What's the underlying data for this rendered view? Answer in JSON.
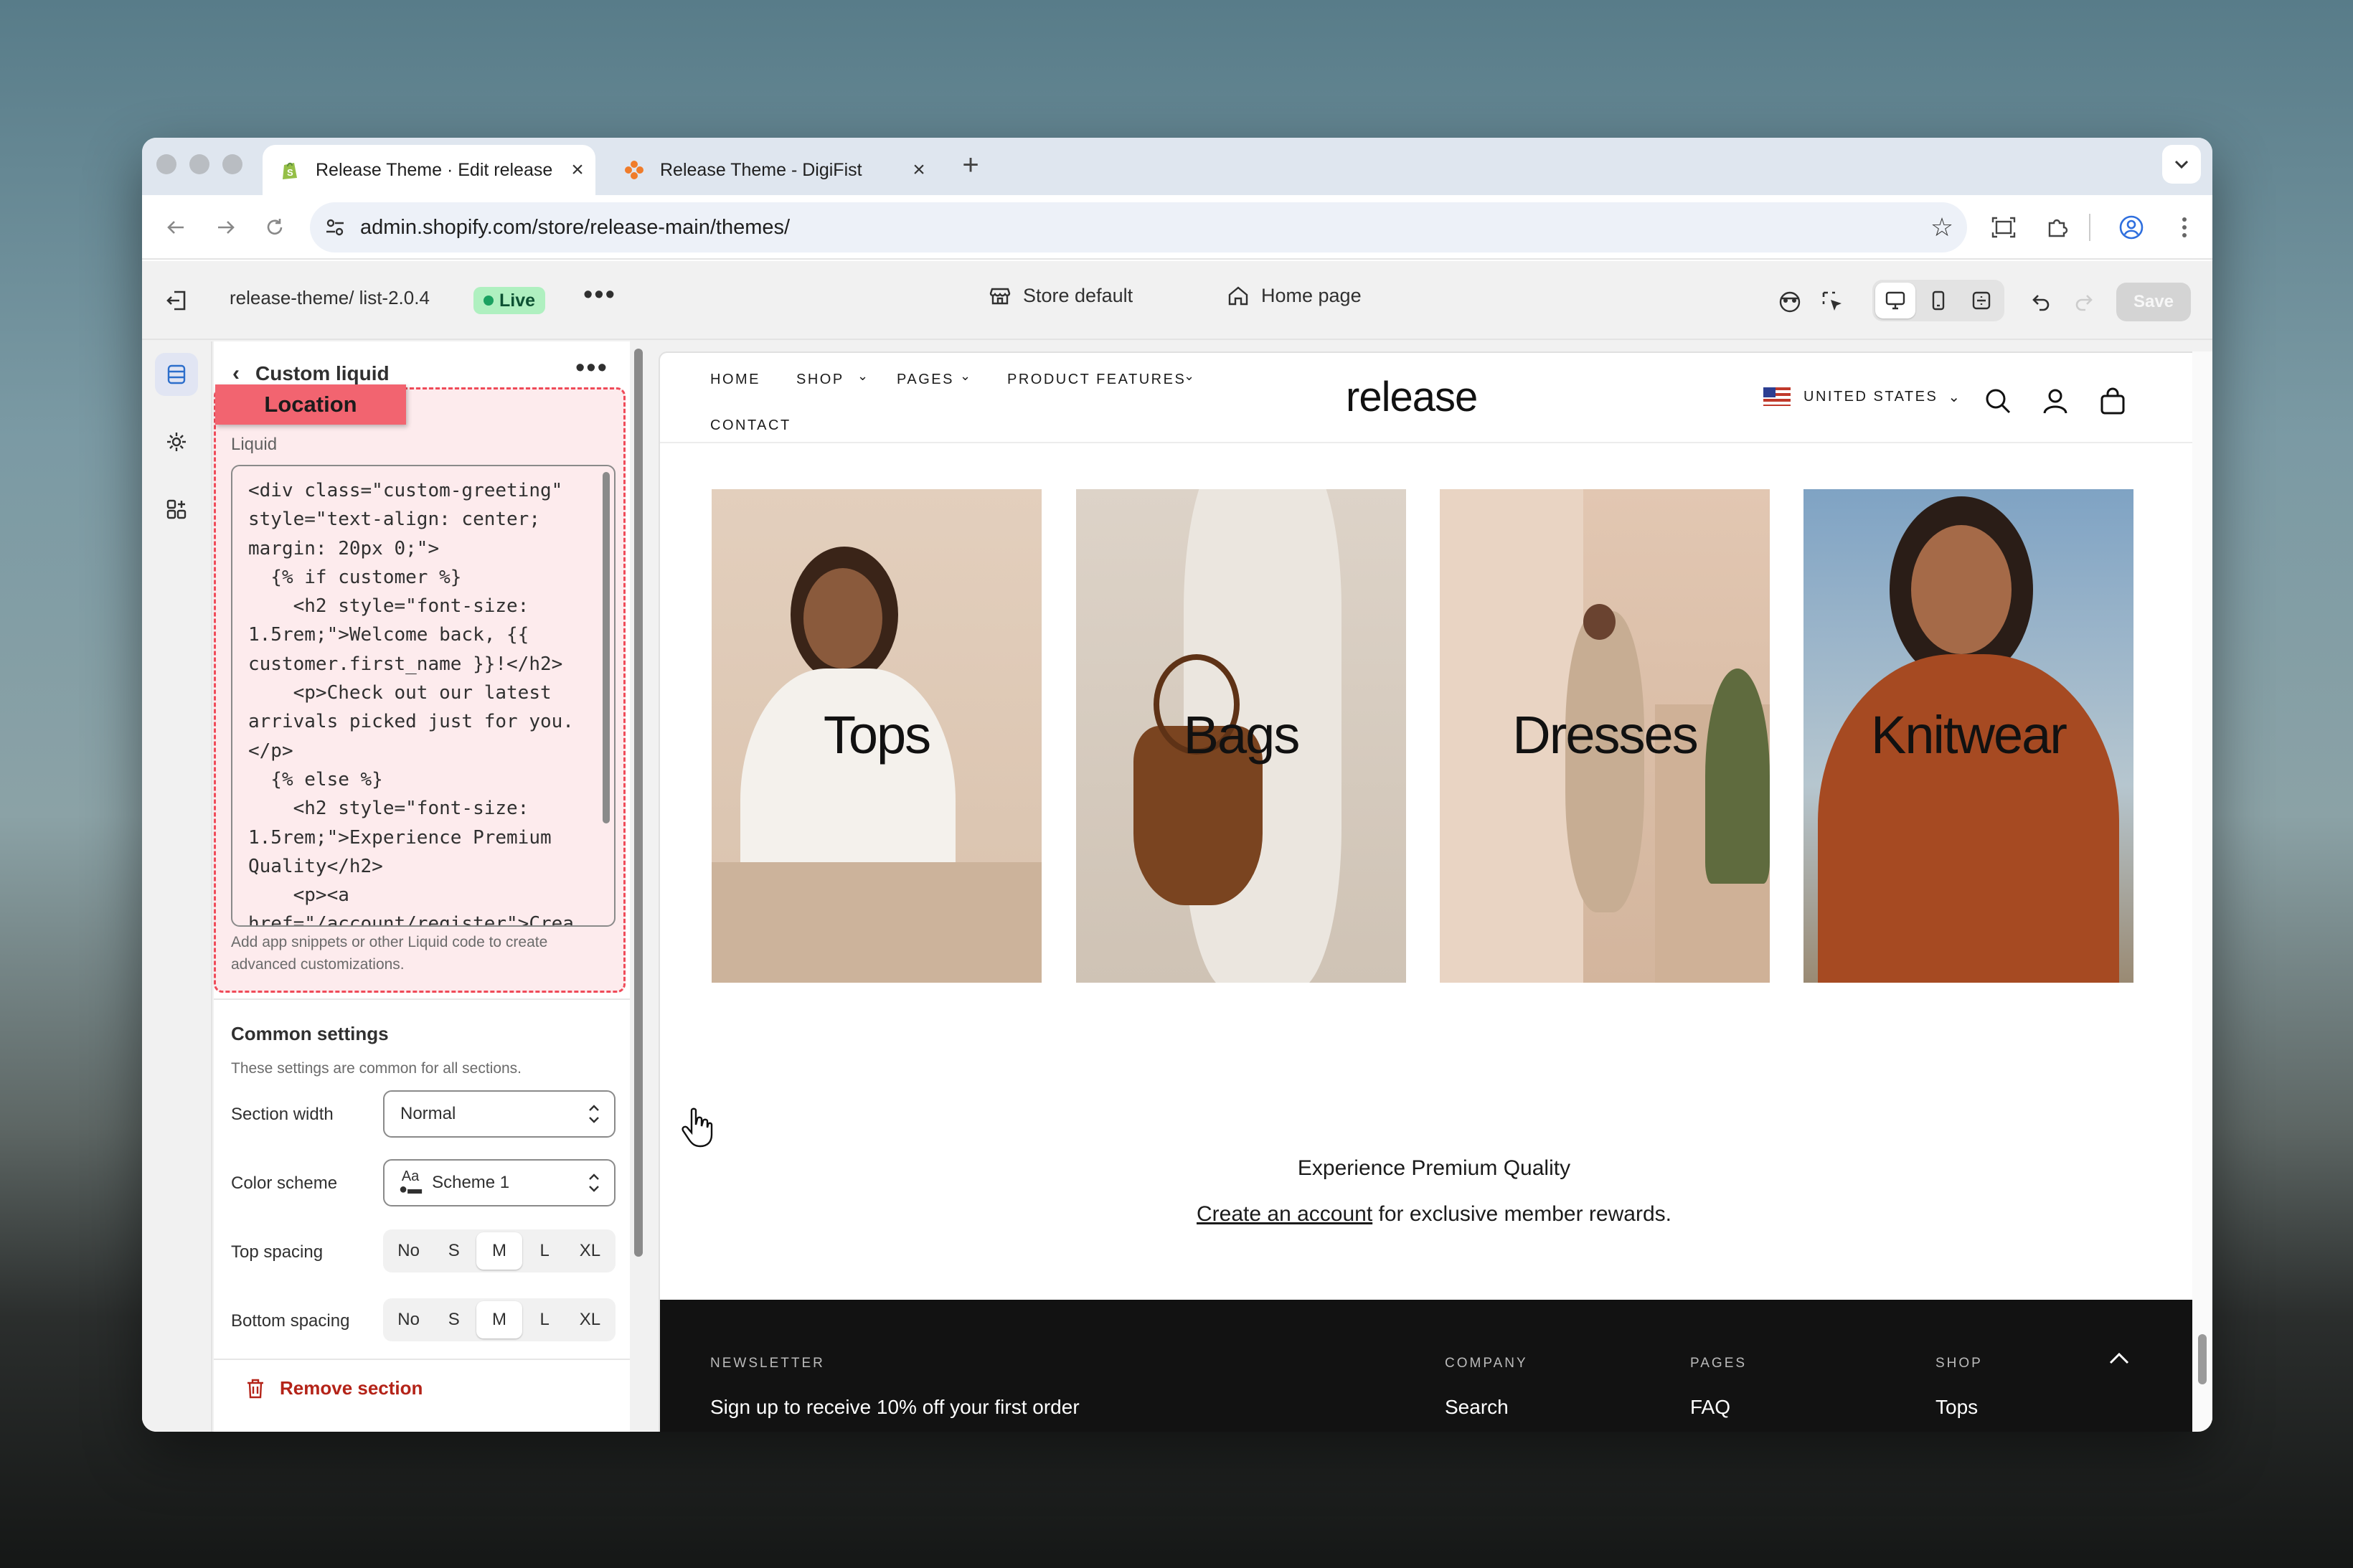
{
  "browser": {
    "tabs": [
      {
        "title": "Release Theme · Edit release",
        "active": true
      },
      {
        "title": "Release Theme - DigiFist",
        "active": false
      }
    ],
    "url": "admin.shopify.com/store/release-main/themes/"
  },
  "editor": {
    "theme_name": "release-theme/ list-2.0.4",
    "live_badge": "Live",
    "store_selector": "Store default",
    "page_selector": "Home page",
    "save_label": "Save"
  },
  "panel": {
    "title": "Custom liquid",
    "highlight_label": "Location",
    "liquid_label": "Liquid",
    "code": "<div class=\"custom-greeting\"\nstyle=\"text-align: center;\nmargin: 20px 0;\">\n  {% if customer %}\n    <h2 style=\"font-size:\n1.5rem;\">Welcome back, {{\ncustomer.first_name }}!</h2>\n    <p>Check out our latest\narrivals picked just for you.\n</p>\n  {% else %}\n    <h2 style=\"font-size:\n1.5rem;\">Experience Premium\nQuality</h2>\n    <p><a\nhref=\"/account/register\">Crea",
    "help_text": "Add app snippets or other Liquid code to create advanced customizations.",
    "common_title": "Common settings",
    "common_sub": "These settings are common for all sections.",
    "section_width_label": "Section width",
    "section_width_value": "Normal",
    "color_scheme_label": "Color scheme",
    "color_scheme_value": "Scheme 1",
    "color_scheme_icon": "Aa",
    "top_spacing_label": "Top spacing",
    "bottom_spacing_label": "Bottom spacing",
    "spacing_options": [
      "No",
      "S",
      "M",
      "L",
      "XL"
    ],
    "spacing_selected": "M",
    "remove_label": "Remove section"
  },
  "store": {
    "nav": [
      "HOME",
      "SHOP",
      "PAGES",
      "PRODUCT FEATURES",
      "CONTACT"
    ],
    "logo": "release",
    "country": "UNITED STATES",
    "collections": [
      "Tops",
      "Bags",
      "Dresses",
      "Knitwear"
    ],
    "greeting_title": "Experience Premium Quality",
    "account_link": "Create an account",
    "account_rest": " for exclusive member rewards.",
    "footer": {
      "newsletter_head": "NEWSLETTER",
      "newsletter_text": "Sign up to receive 10% off your first order",
      "company_head": "COMPANY",
      "company_link": "Search",
      "pages_head": "PAGES",
      "pages_link": "FAQ",
      "shop_head": "SHOP",
      "shop_link": "Tops"
    }
  },
  "colors": {
    "accent_dash": "#ef4b59",
    "live_bg": "#aff0c0",
    "remove": "#b42318"
  }
}
